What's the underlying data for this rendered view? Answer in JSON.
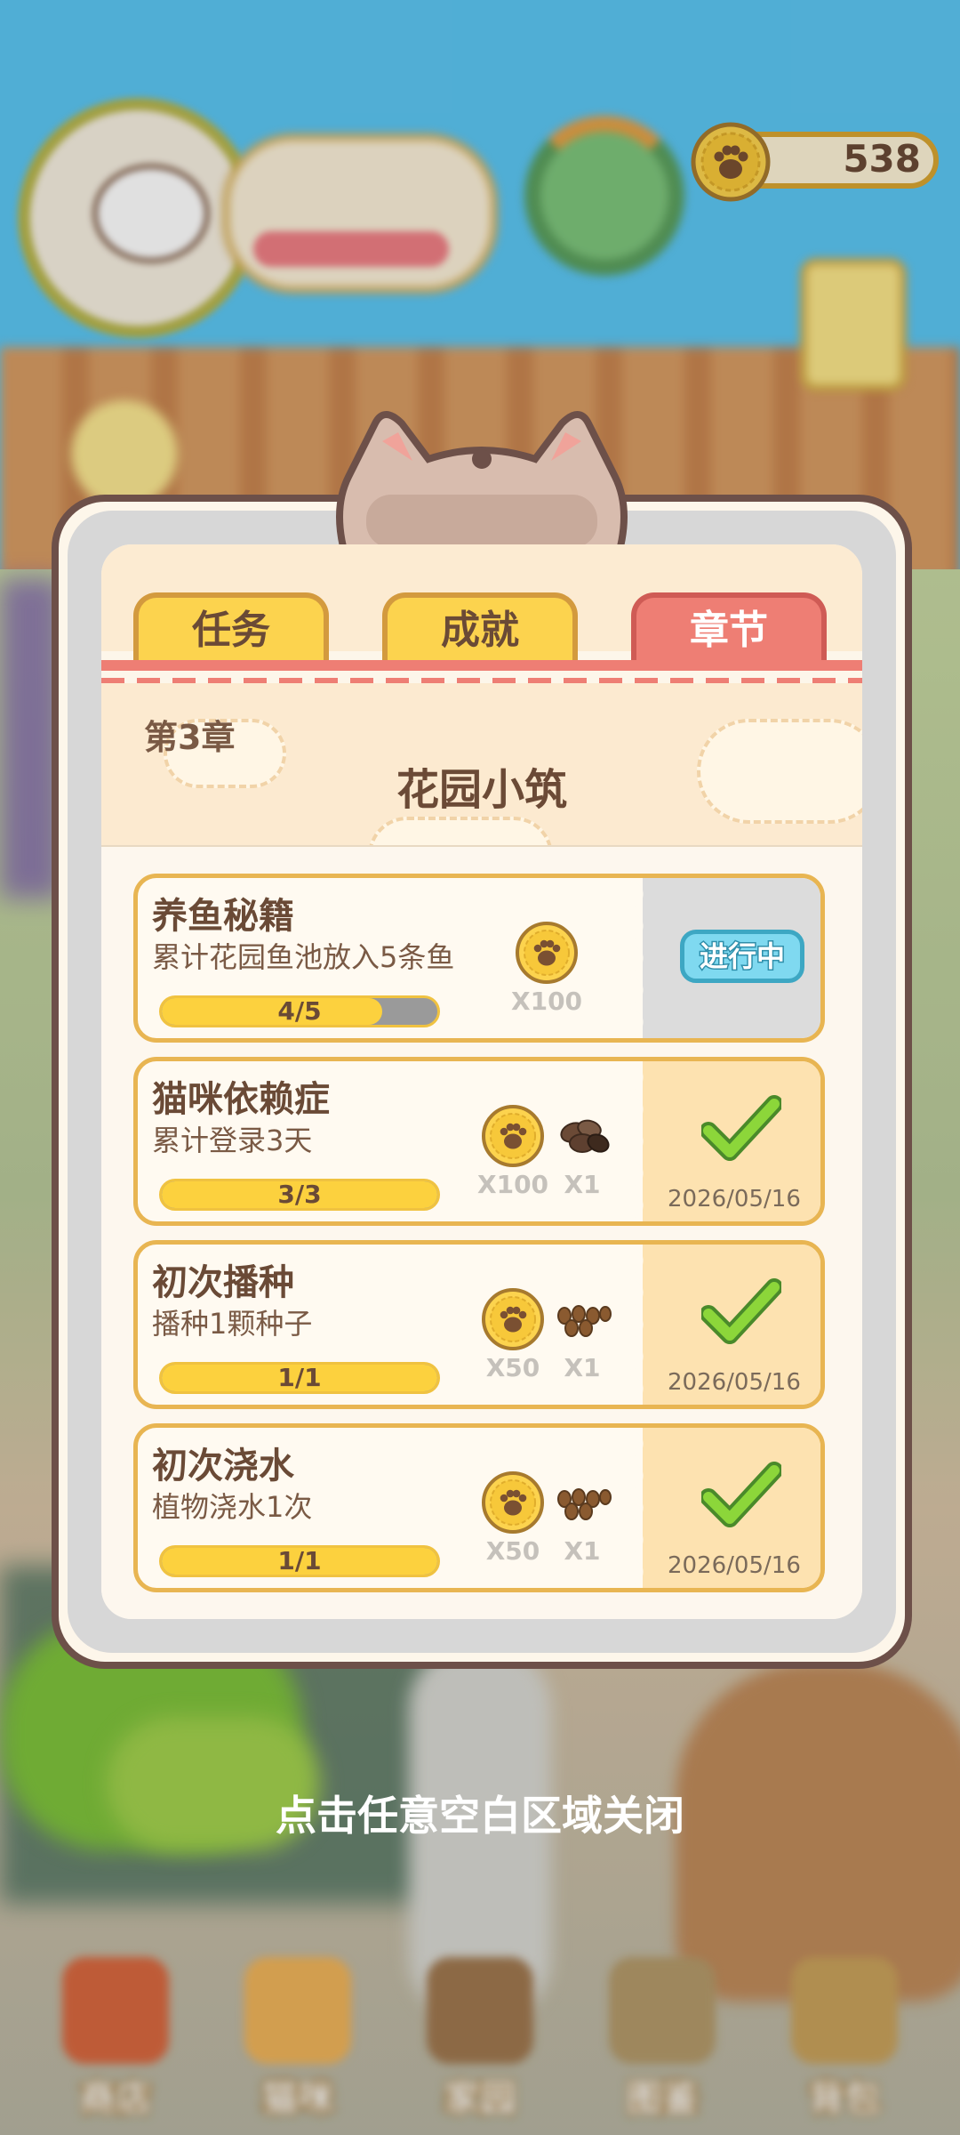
{
  "hud": {
    "coins": "538"
  },
  "tabs": [
    {
      "label": "任务",
      "active": false
    },
    {
      "label": "成就",
      "active": false
    },
    {
      "label": "章节",
      "active": true
    }
  ],
  "chapter": {
    "number": "第3章",
    "title": "花园小筑"
  },
  "tasks": [
    {
      "title": "养鱼秘籍",
      "desc": "累计花园鱼池放入5条鱼",
      "progress_text": "4/5",
      "progress": 0.8,
      "rewards": [
        {
          "icon": "paw-coin-icon",
          "qty": "X100"
        }
      ],
      "status": "in_progress",
      "status_label": "进行中"
    },
    {
      "title": "猫咪依赖症",
      "desc": "累计登录3天",
      "progress_text": "3/3",
      "progress": 1.0,
      "rewards": [
        {
          "icon": "paw-coin-icon",
          "qty": "X100"
        },
        {
          "icon": "coffee-beans-icon",
          "qty": "X1"
        }
      ],
      "status": "done",
      "date": "2026/05/16"
    },
    {
      "title": "初次播种",
      "desc": "播种1颗种子",
      "progress_text": "1/1",
      "progress": 1.0,
      "rewards": [
        {
          "icon": "paw-coin-icon",
          "qty": "X50"
        },
        {
          "icon": "seeds-icon",
          "qty": "X1"
        }
      ],
      "status": "done",
      "date": "2026/05/16"
    },
    {
      "title": "初次浇水",
      "desc": "植物浇水1次",
      "progress_text": "1/1",
      "progress": 1.0,
      "rewards": [
        {
          "icon": "paw-coin-icon",
          "qty": "X50"
        },
        {
          "icon": "seeds-icon",
          "qty": "X1"
        }
      ],
      "status": "done",
      "date": "2026/05/16"
    }
  ],
  "close_hint": "点击任意空白区域关闭",
  "bottom_nav": [
    {
      "label": "商店",
      "icon": "shop-icon"
    },
    {
      "label": "猫咪",
      "icon": "cat-icon"
    },
    {
      "label": "家园",
      "icon": "home-icon"
    },
    {
      "label": "图鉴",
      "icon": "collection-icon"
    },
    {
      "label": "背包",
      "icon": "bag-icon"
    }
  ],
  "colors": {
    "accent_red": "#ee7e74",
    "gold": "#fcd34e",
    "brown_text": "#6a4a36",
    "sky": "#5cc6f3"
  }
}
